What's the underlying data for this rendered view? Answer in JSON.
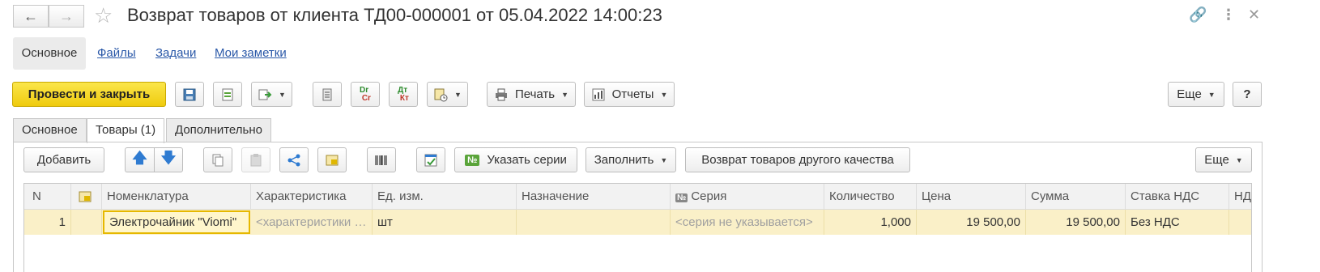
{
  "window": {
    "title": "Возврат товаров от клиента ТД00-000001 от 05.04.2022 14:00:23"
  },
  "nav_tabs": [
    "Основное",
    "Файлы",
    "Задачи",
    "Мои заметки"
  ],
  "toolbar": {
    "post_close": "Провести и закрыть",
    "print": "Печать",
    "reports": "Отчеты",
    "more": "Еще",
    "help": "?"
  },
  "form_tabs": [
    "Основное",
    "Товары (1)",
    "Дополнительно"
  ],
  "table_toolbar": {
    "add": "Добавить",
    "specify_series": "Указать серии",
    "fill": "Заполнить",
    "return_other_quality": "Возврат товаров другого качества",
    "more": "Еще"
  },
  "table": {
    "headers": [
      "N",
      "",
      "Номенклатура",
      "Характеристика",
      "Ед. изм.",
      "Назначение",
      "Серия",
      "Количество",
      "Цена",
      "Сумма",
      "Ставка НДС",
      "НД"
    ],
    "rows": [
      {
        "n": "1",
        "nomenclature": "Электрочайник \"Viomi\"",
        "characteristic": "<характеристики не используются>",
        "unit": "шт",
        "purpose": "",
        "series": "<серия не указывается>",
        "quantity": "1,000",
        "price": "19 500,00",
        "sum": "19 500,00",
        "vat_rate": "Без НДС"
      }
    ]
  },
  "colors": {
    "primary_button": "#f5d522",
    "selected_row": "#faf0c8",
    "link": "#2a58a8"
  }
}
